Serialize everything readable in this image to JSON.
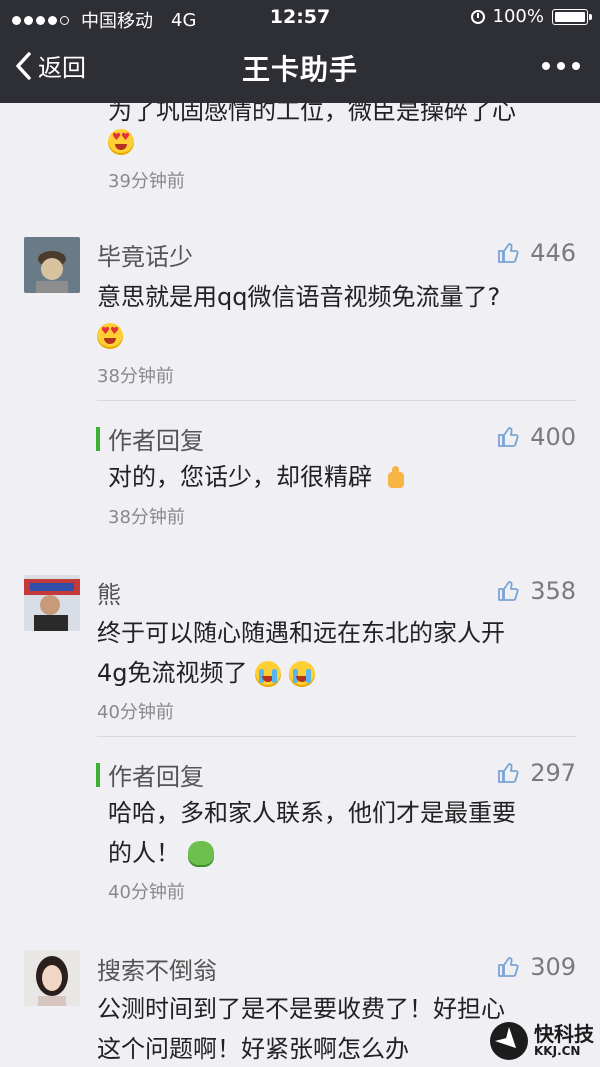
{
  "status_bar": {
    "carrier": "中国移动",
    "network": "4G",
    "time": "12:57",
    "battery": "100%"
  },
  "nav": {
    "back_label": "返回",
    "title": "王卡助手"
  },
  "partial_comment": {
    "text": "为了巩固感情的工位，微臣是操碎了心",
    "time": "39分钟前"
  },
  "comments": [
    {
      "name": "毕竟话少",
      "likes": "446",
      "text": "意思就是用qq微信语音视频免流量了?",
      "time": "38分钟前",
      "reply": {
        "label": "作者回复",
        "likes": "400",
        "text": "对的，您话少，却很精辟",
        "time": "38分钟前"
      }
    },
    {
      "name": "熊",
      "likes": "358",
      "text_line1": "终于可以随心随遇和远在东北的家人开",
      "text_line2": "4g免流视频了",
      "time": "40分钟前",
      "reply": {
        "label": "作者回复",
        "likes": "297",
        "text_line1": "哈哈，多和家人联系，他们才是最重要",
        "text_line2": "的人！",
        "time": "40分钟前"
      }
    },
    {
      "name": "搜索不倒翁",
      "likes": "309",
      "text_line1": "公测时间到了是不是要收费了！好担心",
      "text_line2": "这个问题啊！好紧张啊怎么办"
    }
  ],
  "watermark": {
    "brand": "快科技",
    "domain": "KKJ.CN"
  },
  "colors": {
    "nav_bg": "#2e2f34",
    "page_bg": "#efeff4",
    "reply_bar": "#3cb034"
  }
}
